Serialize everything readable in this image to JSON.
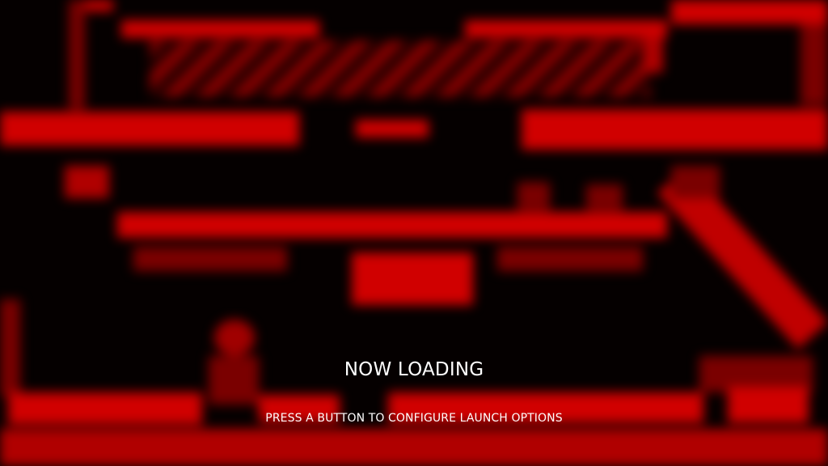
{
  "loading": {
    "status": "NOW LOADING",
    "hint": "PRESS A BUTTON TO CONFIGURE LAUNCH OPTIONS"
  },
  "colors": {
    "background": "#050000",
    "accent": "#d00000",
    "text": "#ffffff"
  }
}
